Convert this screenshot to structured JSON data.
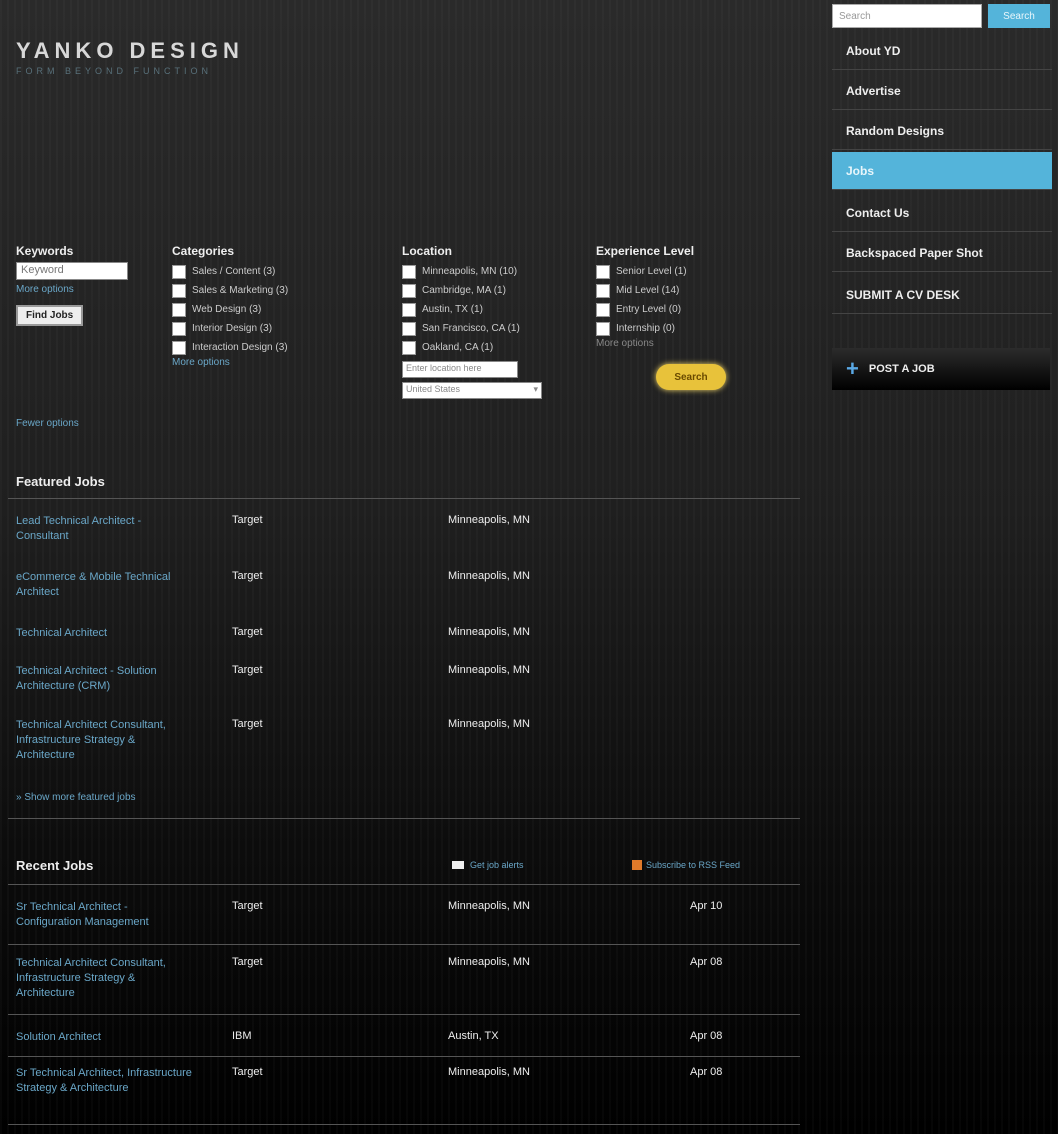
{
  "site": {
    "logo": "YANKO DESIGN",
    "tagline": "FORM BEYOND FUNCTION"
  },
  "search": {
    "placeholder": "Search",
    "button": "Search"
  },
  "nav": [
    {
      "label": "About YD"
    },
    {
      "label": "Advertise"
    },
    {
      "label": "Random Designs"
    },
    {
      "label": "Jobs",
      "active": true
    },
    {
      "label": "Contact Us"
    },
    {
      "label": "Backspaced Paper Shot"
    },
    {
      "label": "SUBMIT A CV DESK"
    }
  ],
  "post_job": "POST A JOB",
  "filters": {
    "keywords_label": "Keywords",
    "keywords_value": "Keyword",
    "more_options": "More options",
    "find_button": "Find Jobs",
    "fewer_options": "Fewer options",
    "categories_label": "Categories",
    "categories": [
      "Sales / Content (3)",
      "Sales & Marketing (3)",
      "Web Design (3)",
      "Interior Design (3)",
      "Interaction Design (3)"
    ],
    "categories_more": "More options",
    "location_label": "Location",
    "locations": [
      "Minneapolis, MN (10)",
      "Cambridge, MA (1)",
      "Austin, TX (1)",
      "San Francisco, CA (1)",
      "Oakland, CA (1)"
    ],
    "location_other_placeholder": "Enter location here",
    "location_select": "United States",
    "experience_label": "Experience Level",
    "experience": [
      "Senior Level (1)",
      "Mid Level (14)",
      "Entry Level (0)",
      "Internship (0)"
    ],
    "experience_more": "More options",
    "go_button": "Search"
  },
  "featured": {
    "title": "Featured Jobs",
    "jobs": [
      {
        "title": "Lead Technical Architect - Consultant",
        "company": "Target",
        "location": "Minneapolis, MN"
      },
      {
        "title": "eCommerce & Mobile Technical Architect",
        "company": "Target",
        "location": "Minneapolis, MN"
      },
      {
        "title": "Technical Architect",
        "company": "Target",
        "location": "Minneapolis, MN"
      },
      {
        "title": "Technical Architect - Solution Architecture (CRM)",
        "company": "Target",
        "location": "Minneapolis, MN"
      },
      {
        "title": "Technical Architect Consultant, Infrastructure Strategy & Architecture",
        "company": "Target",
        "location": "Minneapolis, MN"
      }
    ],
    "more": "» Show more featured jobs"
  },
  "recent": {
    "title": "Recent Jobs",
    "alerts": "Get job alerts",
    "rss": "Subscribe to RSS Feed",
    "jobs": [
      {
        "title": "Sr Technical Architect - Configuration Management",
        "company": "Target",
        "location": "Minneapolis, MN",
        "date": "Apr 10"
      },
      {
        "title": "Technical Architect Consultant, Infrastructure Strategy & Architecture",
        "company": "Target",
        "location": "Minneapolis, MN",
        "date": "Apr 08"
      },
      {
        "title": "Solution Architect",
        "company": "IBM",
        "location": "Austin, TX",
        "date": "Apr 08"
      },
      {
        "title": "Sr Technical Architect, Infrastructure Strategy & Architecture",
        "company": "Target",
        "location": "Minneapolis, MN",
        "date": "Apr 08"
      }
    ]
  }
}
